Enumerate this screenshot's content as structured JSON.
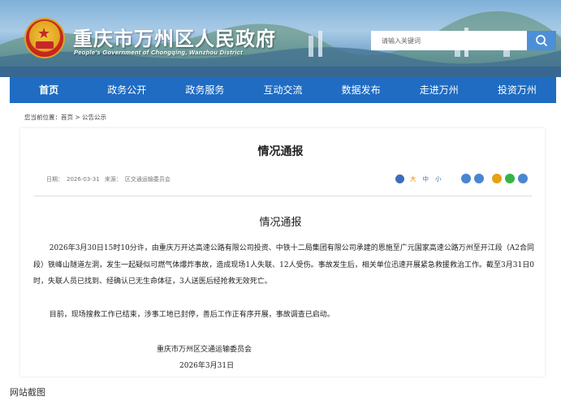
{
  "header": {
    "title": "重庆市万州区人民政府",
    "subtitle": "People's Government of Chongqing, Wanzhou District",
    "search_placeholder": "请输入关键词"
  },
  "nav": {
    "items": [
      "首页",
      "政务公开",
      "政务服务",
      "互动交流",
      "数据发布",
      "走进万州",
      "投资万州"
    ]
  },
  "breadcrumb": {
    "label": "您当前位置：",
    "path": "首页 > 公告公示"
  },
  "article": {
    "page_title": "情况通报",
    "date_label": "日期：",
    "date": "2026-03-31",
    "source_label": "来源：",
    "source": "区交通运输委员会",
    "font_sizes": [
      "大",
      "中",
      "小"
    ],
    "title": "情况通报",
    "paragraphs": [
      "2026年3月30日15时10分许，由重庆万开达高速公路有限公司投资、中铁十二局集团有限公司承建的恩施至广元国家高速公路万州至开江段（A2合同段）铁峰山隧道左洞，发生一起疑似可燃气体爆炸事故，造成现场1人失联、12人受伤。事故发生后，相关单位迅速开展紧急救援救治工作。截至3月31日0时，失联人员已找到、经确认已无生命体征，3人送医后经抢救无效死亡。",
      "目前，现场搜救工作已结束，涉事工地已封停，善后工作正有序开展，事故调查已启动。"
    ],
    "signature": "重庆市万州区交通运输委员会",
    "sign_date": "2026年3月31日"
  },
  "caption": "网站截图",
  "colors": {
    "nav_bg": "#1f6cc2",
    "search_button": "#4d8fd6"
  }
}
